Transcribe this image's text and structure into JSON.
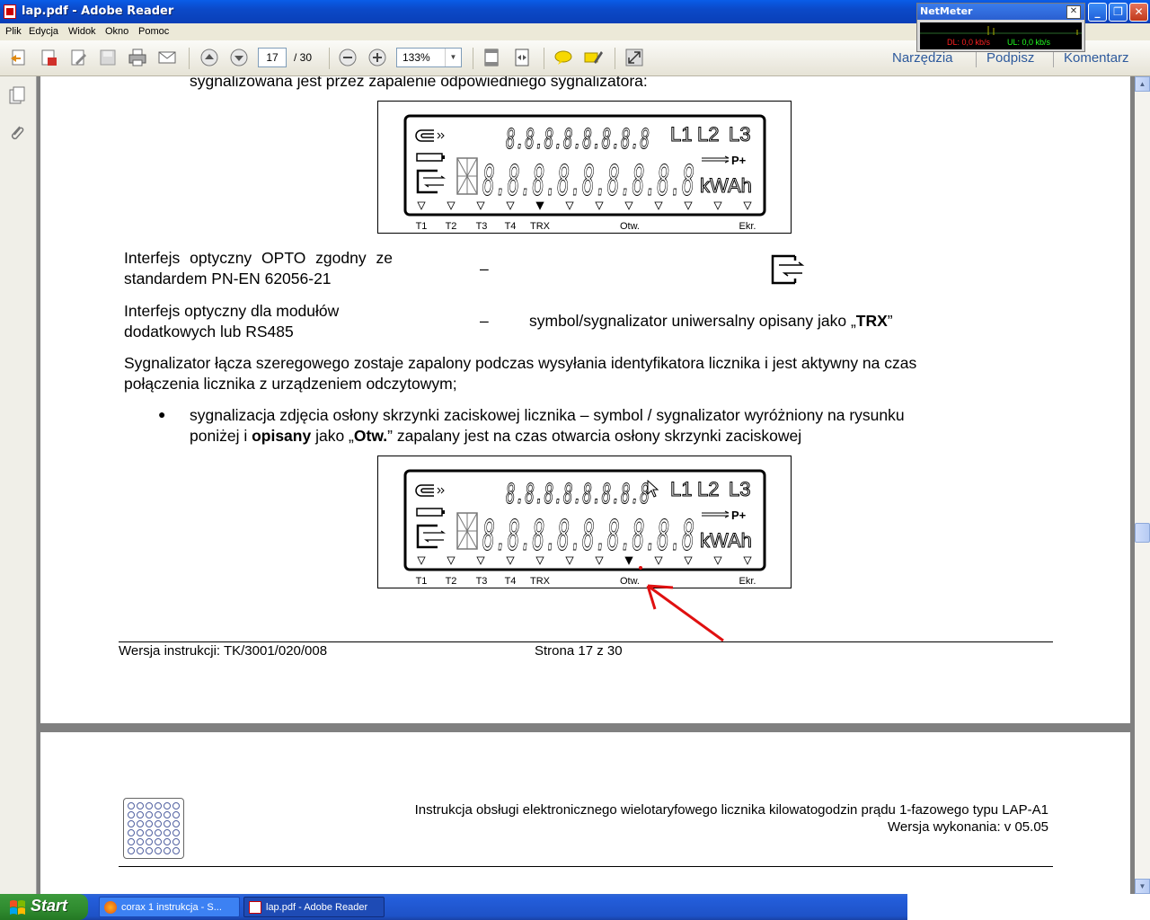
{
  "window": {
    "title": "lap.pdf - Adobe Reader",
    "btn_min": "_",
    "btn_max": "❐",
    "btn_close": "✕"
  },
  "netmeter": {
    "title": "NetMeter",
    "close": "✕",
    "dl": "DL: 0,0 kb/s",
    "ul": "UL: 0,0 kb/s"
  },
  "menu": [
    "Plik",
    "Edycja",
    "Widok",
    "Okno",
    "Pomoc"
  ],
  "toolbar": {
    "page_current": "17",
    "page_total": "/ 30",
    "zoom": "133%",
    "tools": "Narzędzia",
    "sign": "Podpisz",
    "comment": "Komentarz"
  },
  "page1": {
    "top_line": "sygnalizowana jest przez zapalenie odpowiedniego sygnalizatora:",
    "opto_line1": "Interfejs optyczny OPTO zgodny ze",
    "opto_line2": "standardem PN-EN 62056-21",
    "dash1": "–",
    "modul_line1": "Interfejs optyczny dla modułów",
    "modul_line2": "dodatkowych lub RS485",
    "dash2": "–",
    "trx_desc_prefix": "symbol/sygnalizator uniwersalny opisany jako „",
    "trx_desc_bold": "TRX",
    "trx_desc_suffix": "”",
    "para_line1": "Sygnalizator łącza szeregowego zostaje zapalony podczas wysyłania identyfikatora licznika i jest aktywny na czas",
    "para_line2": "połączenia licznika z urządzeniem odczytowym;",
    "bullet": "●",
    "bullet_line1": "sygnalizacja zdjęcia osłony skrzynki zaciskowej licznika – symbol / sygnalizator wyróżniony na rysunku",
    "bullet_line2_a": "poniżej i ",
    "bullet_line2_b": "opisany",
    "bullet_line2_c": " jako „",
    "bullet_line2_d": "Otw.",
    "bullet_line2_e": "” zapalany jest na czas otwarcia osłony skrzynki zaciskowej",
    "footer_version": "Wersja instrukcji: TK/3001/020/008",
    "footer_page": "Strona 17 z 30"
  },
  "lcd": {
    "digits_top": "8.8.8.8.8.8.8.8",
    "digits_main": "8.8.8.8.8.8.8.8.8",
    "phases": [
      "L1",
      "L2",
      "L3"
    ],
    "pplus": "P+",
    "unit": "kWAh",
    "labels": {
      "t1": "T1",
      "t2": "T2",
      "t3": "T3",
      "t4": "T4",
      "trx": "TRX",
      "otw": "Otw.",
      "ekr": "Ekr."
    },
    "lcd1_active": "TRX",
    "lcd2_active": "Otw."
  },
  "page2": {
    "header_line1": "Instrukcja obsługi elektronicznego wielotaryfowego licznika kilowatogodzin prądu 1-fazowego typu LAP-A1",
    "header_line2": "Wersja wykonania: v 05.05"
  },
  "taskbar": {
    "start": "Start",
    "task1": "corax 1 instrukcja - S...",
    "task2": "lap.pdf - Adobe Reader"
  },
  "colors": {
    "arrow": "#e01010",
    "link": "#2e5a9c",
    "titlebar": "#0b49c8"
  }
}
